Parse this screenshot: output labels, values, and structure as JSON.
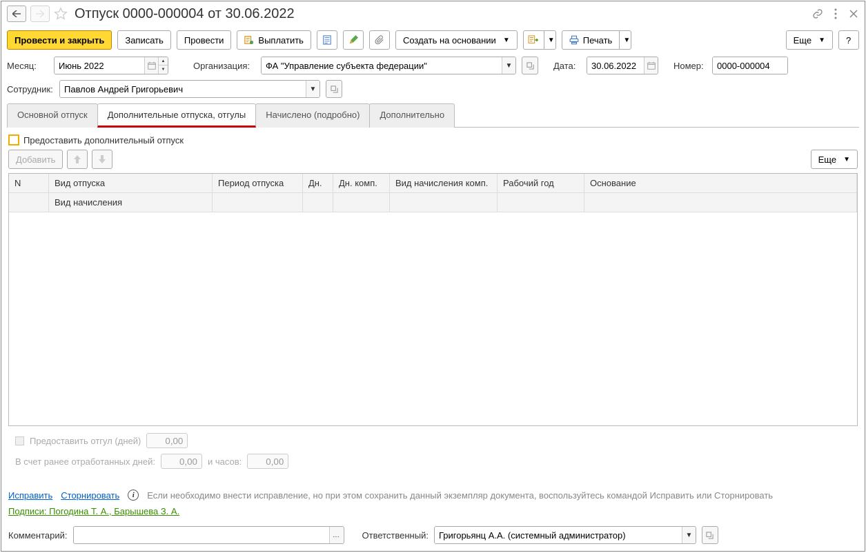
{
  "title": "Отпуск 0000-000004 от 30.06.2022",
  "toolbar": {
    "process_close": "Провести и закрыть",
    "save": "Записать",
    "process": "Провести",
    "pay": "Выплатить",
    "create_based": "Создать на основании",
    "print": "Печать",
    "more": "Еще",
    "help": "?"
  },
  "form": {
    "month_label": "Месяц:",
    "month_value": "Июнь 2022",
    "org_label": "Организация:",
    "org_value": "ФА \"Управление субъекта федерации\"",
    "date_label": "Дата:",
    "date_value": "30.06.2022",
    "number_label": "Номер:",
    "number_value": "0000-000004",
    "employee_label": "Сотрудник:",
    "employee_value": "Павлов Андрей Григорьевич"
  },
  "tabs": {
    "main": "Основной отпуск",
    "additional": "Дополнительные отпуска, отгулы",
    "accrued": "Начислено (подробно)",
    "extra": "Дополнительно"
  },
  "tabcontent": {
    "provide_label": "Предоставить дополнительный отпуск",
    "add_btn": "Добавить",
    "more_btn": "Еще",
    "table": {
      "col_n": "N",
      "col_type": "Вид отпуска",
      "col_type2": "Вид начисления",
      "col_period": "Период отпуска",
      "col_dn": "Дн.",
      "col_dnk": "Дн. комп.",
      "col_nk": "Вид начисления комп.",
      "col_year": "Рабочий год",
      "col_base": "Основание"
    },
    "otgul_label": "Предоставить отгул (дней)",
    "otgul_value": "0,00",
    "worked_label": "В счет ранее отработанных дней:",
    "worked_value": "0,00",
    "hours_label": "и часов:",
    "hours_value": "0,00"
  },
  "footer": {
    "fix": "Исправить",
    "storno": "Сторнировать",
    "info": "Если необходимо внести исправление, но при этом сохранить данный экземпляр документа, воспользуйтесь командой Исправить или Сторнировать",
    "signatures": "Подписи: Погодина Т. А., Барышева З. А."
  },
  "bottom": {
    "comment_label": "Комментарий:",
    "comment_value": "",
    "responsible_label": "Ответственный:",
    "responsible_value": "Григорьянц А.А. (системный администратор)"
  }
}
